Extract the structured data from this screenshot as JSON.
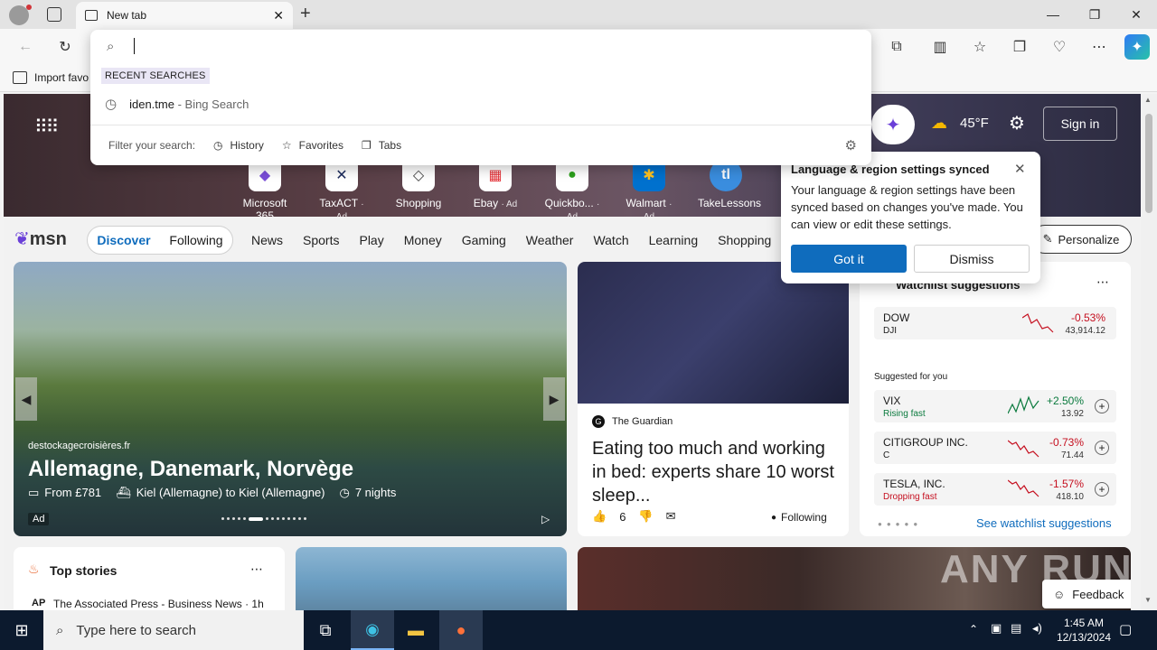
{
  "browser": {
    "tab_title": "New tab",
    "new_tab_symbol": "+",
    "favorites_bar_item": "Import favo",
    "window_controls": [
      "—",
      "❐",
      "✕"
    ]
  },
  "omnibox": {
    "recent_label": "RECENT SEARCHES",
    "recent_item_text": "iden.tme",
    "recent_item_suffix": " - Bing Search",
    "filter_label": "Filter your search:",
    "filters": [
      "History",
      "Favorites",
      "Tabs"
    ]
  },
  "header": {
    "weather": "45°F",
    "sign_in": "Sign in"
  },
  "shortcuts": [
    {
      "label": "Microsoft 365",
      "ad": ""
    },
    {
      "label": "TaxACT",
      "ad": "· Ad"
    },
    {
      "label": "Shopping",
      "ad": ""
    },
    {
      "label": "Ebay",
      "ad": "· Ad"
    },
    {
      "label": "Quickbo...",
      "ad": "· Ad"
    },
    {
      "label": "Walmart",
      "ad": "· Ad"
    },
    {
      "label": "TakeLessons",
      "ad": ""
    }
  ],
  "nav": {
    "logo": "msn",
    "discover": "Discover",
    "following": "Following",
    "items": [
      "News",
      "Sports",
      "Play",
      "Money",
      "Gaming",
      "Weather",
      "Watch",
      "Learning",
      "Shopping"
    ],
    "personalize": "Personalize"
  },
  "hero_card": {
    "source": "destockagecroisières.fr",
    "title": "Allemagne, Danemark, Norvège",
    "price": "From £781",
    "route": "Kiel (Allemagne) to Kiel (Allemagne)",
    "duration": "7 nights",
    "ad": "Ad"
  },
  "news_card": {
    "source": "The Guardian",
    "headline": "Eating too much and working in bed: experts share 10 worst sleep...",
    "likes": "6",
    "following": "Following"
  },
  "watchlist": {
    "title": "Watchlist suggestions",
    "rows": [
      {
        "symbol": "DOW",
        "sub": "DJI",
        "pct": "-0.53%",
        "price": "43,914.12"
      }
    ],
    "suggested_label": "Suggested for you",
    "suggested": [
      {
        "symbol": "VIX",
        "sub": "Rising fast",
        "pct": "+2.50%",
        "price": "13.92",
        "up": true
      },
      {
        "symbol": "CITIGROUP INC.",
        "sub": "C",
        "pct": "-0.73%",
        "price": "71.44",
        "up": false
      },
      {
        "symbol": "TESLA, INC.",
        "sub": "Dropping fast",
        "pct": "-1.57%",
        "price": "418.10",
        "up": false
      }
    ],
    "see_all": "See watchlist suggestions"
  },
  "popup": {
    "title": "Language & region settings synced",
    "body": "Your language & region settings have been synced based on changes you've made. You can view or edit these settings.",
    "primary": "Got it",
    "secondary": "Dismiss"
  },
  "top_stories": {
    "title": "Top stories",
    "source_abbr": "AP",
    "source_line": "The Associated Press - Business News · 1h"
  },
  "feedback": "Feedback",
  "watermark": "ANY RUN",
  "taskbar": {
    "search_placeholder": "Type here to search",
    "time": "1:45 AM",
    "date": "12/13/2024"
  },
  "colors": {
    "accent": "#0f6cbd",
    "negative": "#c50f1f",
    "positive": "#0b7a3e"
  }
}
